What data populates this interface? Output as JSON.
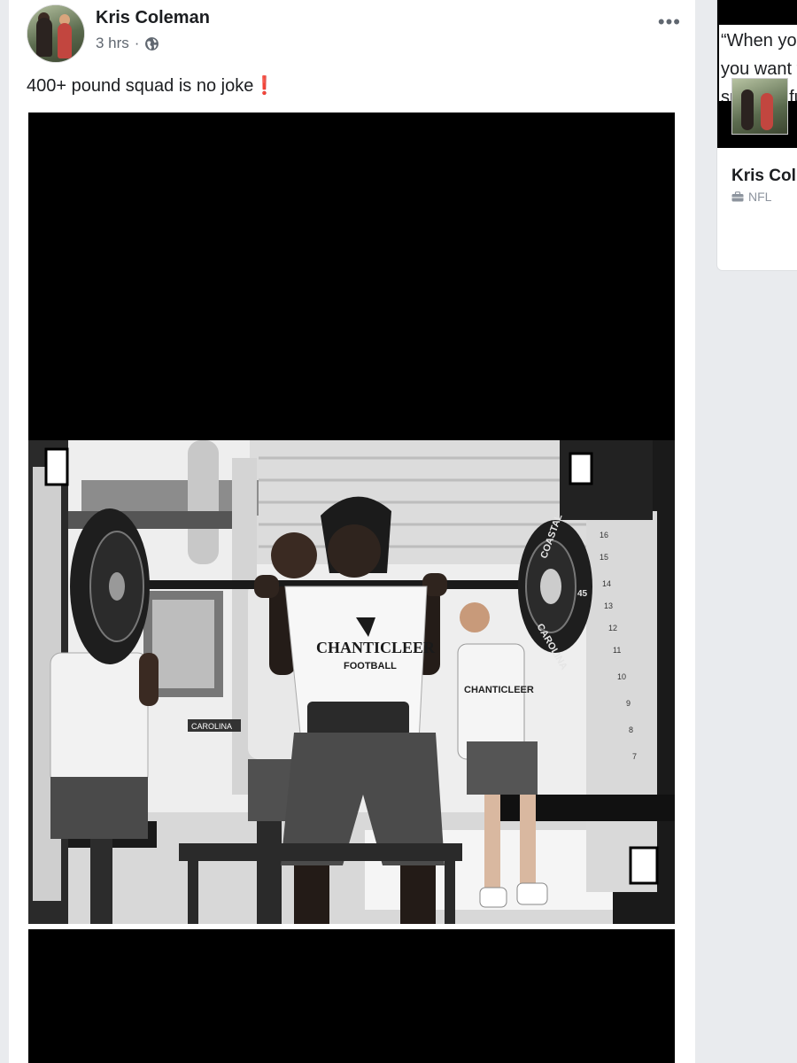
{
  "post": {
    "author": "Kris Coleman",
    "time": "3 hrs",
    "separator": "·",
    "text": "400+ pound squad is no joke",
    "text_emoji": "❗",
    "more_label": "•••"
  },
  "photo": {
    "shirt_text": "CHANTICLEER",
    "shirt_sub": "FOOTBALL",
    "plate_text_1": "COASTAL",
    "plate_text_2": "CAROLINA",
    "plate_number": "45",
    "rack_numbers": [
      "16",
      "15",
      "14",
      "13",
      "12",
      "11",
      "10",
      "9",
      "8",
      "7"
    ],
    "wall_sign": "CAROLINA"
  },
  "sidebar": {
    "quote_line1": "“When yo",
    "quote_line2": "you want t",
    "quote_line3": "su",
    "quote_line3b": "fu",
    "name": "Kris Col",
    "category": "NFL"
  },
  "colors": {
    "background": "#e9ebee",
    "card": "#ffffff",
    "meta_text": "#606770",
    "accent_red": "#d93025"
  }
}
